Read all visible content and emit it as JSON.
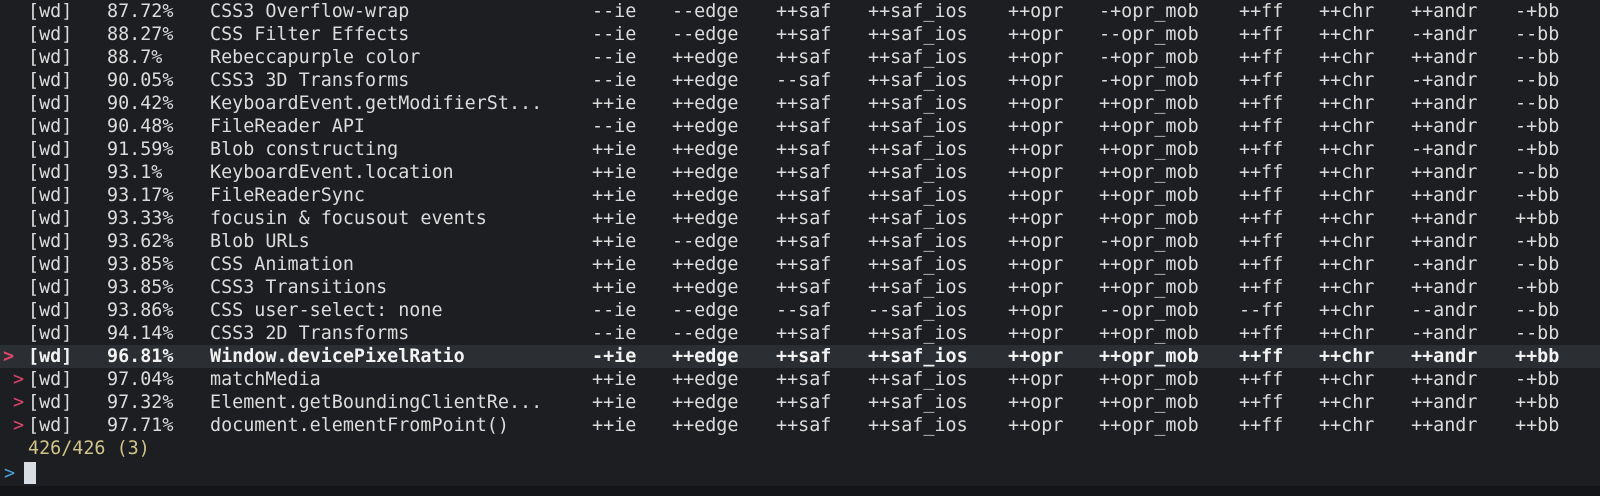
{
  "rows": [
    {
      "marker": "",
      "tag": "[wd]",
      "pct": "87.72%",
      "name": "CSS3 Overflow-wrap",
      "ie": "--ie",
      "edge": "--edge",
      "saf": "++saf",
      "saf_ios": "++saf_ios",
      "opr": "++opr",
      "opr_mob": "-+opr_mob",
      "ff": "++ff",
      "chr": "++chr",
      "andr": "++andr",
      "bb": "-+bb"
    },
    {
      "marker": "",
      "tag": "[wd]",
      "pct": "88.27%",
      "name": "CSS Filter Effects",
      "ie": "--ie",
      "edge": "--edge",
      "saf": "++saf",
      "saf_ios": "++saf_ios",
      "opr": "++opr",
      "opr_mob": "--opr_mob",
      "ff": "++ff",
      "chr": "++chr",
      "andr": "-+andr",
      "bb": "--bb"
    },
    {
      "marker": "",
      "tag": "[wd]",
      "pct": "88.7%",
      "name": "Rebeccapurple color",
      "ie": "--ie",
      "edge": "++edge",
      "saf": "++saf",
      "saf_ios": "++saf_ios",
      "opr": "++opr",
      "opr_mob": "-+opr_mob",
      "ff": "++ff",
      "chr": "++chr",
      "andr": "++andr",
      "bb": "--bb"
    },
    {
      "marker": "",
      "tag": "[wd]",
      "pct": "90.05%",
      "name": "CSS3 3D Transforms",
      "ie": "--ie",
      "edge": "++edge",
      "saf": "--saf",
      "saf_ios": "++saf_ios",
      "opr": "++opr",
      "opr_mob": "-+opr_mob",
      "ff": "++ff",
      "chr": "++chr",
      "andr": "-+andr",
      "bb": "--bb"
    },
    {
      "marker": "",
      "tag": "[wd]",
      "pct": "90.42%",
      "name": "KeyboardEvent.getModifierSt...",
      "ie": "++ie",
      "edge": "++edge",
      "saf": "++saf",
      "saf_ios": "++saf_ios",
      "opr": "++opr",
      "opr_mob": "++opr_mob",
      "ff": "++ff",
      "chr": "++chr",
      "andr": "++andr",
      "bb": "--bb"
    },
    {
      "marker": "",
      "tag": "[wd]",
      "pct": "90.48%",
      "name": "FileReader API",
      "ie": "--ie",
      "edge": "++edge",
      "saf": "++saf",
      "saf_ios": "++saf_ios",
      "opr": "++opr",
      "opr_mob": "++opr_mob",
      "ff": "++ff",
      "chr": "++chr",
      "andr": "++andr",
      "bb": "-+bb"
    },
    {
      "marker": "",
      "tag": "[wd]",
      "pct": "91.59%",
      "name": "Blob constructing",
      "ie": "++ie",
      "edge": "++edge",
      "saf": "++saf",
      "saf_ios": "++saf_ios",
      "opr": "++opr",
      "opr_mob": "++opr_mob",
      "ff": "++ff",
      "chr": "++chr",
      "andr": "-+andr",
      "bb": "-+bb"
    },
    {
      "marker": "",
      "tag": "[wd]",
      "pct": "93.1%",
      "name": "KeyboardEvent.location",
      "ie": "++ie",
      "edge": "++edge",
      "saf": "++saf",
      "saf_ios": "++saf_ios",
      "opr": "++opr",
      "opr_mob": "++opr_mob",
      "ff": "++ff",
      "chr": "++chr",
      "andr": "++andr",
      "bb": "--bb"
    },
    {
      "marker": "",
      "tag": "[wd]",
      "pct": "93.17%",
      "name": "FileReaderSync",
      "ie": "++ie",
      "edge": "++edge",
      "saf": "++saf",
      "saf_ios": "++saf_ios",
      "opr": "++opr",
      "opr_mob": "++opr_mob",
      "ff": "++ff",
      "chr": "++chr",
      "andr": "++andr",
      "bb": "-+bb"
    },
    {
      "marker": "",
      "tag": "[wd]",
      "pct": "93.33%",
      "name": "focusin & focusout events",
      "ie": "++ie",
      "edge": "++edge",
      "saf": "++saf",
      "saf_ios": "++saf_ios",
      "opr": "++opr",
      "opr_mob": "++opr_mob",
      "ff": "++ff",
      "chr": "++chr",
      "andr": "++andr",
      "bb": "++bb"
    },
    {
      "marker": "",
      "tag": "[wd]",
      "pct": "93.62%",
      "name": "Blob URLs",
      "ie": "++ie",
      "edge": "--edge",
      "saf": "++saf",
      "saf_ios": "++saf_ios",
      "opr": "++opr",
      "opr_mob": "-+opr_mob",
      "ff": "++ff",
      "chr": "++chr",
      "andr": "++andr",
      "bb": "-+bb"
    },
    {
      "marker": "",
      "tag": "[wd]",
      "pct": "93.85%",
      "name": "CSS Animation",
      "ie": "++ie",
      "edge": "++edge",
      "saf": "++saf",
      "saf_ios": "++saf_ios",
      "opr": "++opr",
      "opr_mob": "++opr_mob",
      "ff": "++ff",
      "chr": "++chr",
      "andr": "-+andr",
      "bb": "--bb"
    },
    {
      "marker": "",
      "tag": "[wd]",
      "pct": "93.85%",
      "name": "CSS3 Transitions",
      "ie": "++ie",
      "edge": "++edge",
      "saf": "++saf",
      "saf_ios": "++saf_ios",
      "opr": "++opr",
      "opr_mob": "++opr_mob",
      "ff": "++ff",
      "chr": "++chr",
      "andr": "++andr",
      "bb": "-+bb"
    },
    {
      "marker": "",
      "tag": "[wd]",
      "pct": "93.86%",
      "name": "CSS user-select: none",
      "ie": "--ie",
      "edge": "--edge",
      "saf": "--saf",
      "saf_ios": "--saf_ios",
      "opr": "++opr",
      "opr_mob": "--opr_mob",
      "ff": "--ff",
      "chr": "++chr",
      "andr": "--andr",
      "bb": "--bb"
    },
    {
      "marker": "",
      "tag": "[wd]",
      "pct": "94.14%",
      "name": "CSS3 2D Transforms",
      "ie": "--ie",
      "edge": "--edge",
      "saf": "++saf",
      "saf_ios": "++saf_ios",
      "opr": "++opr",
      "opr_mob": "++opr_mob",
      "ff": "++ff",
      "chr": "++chr",
      "andr": "-+andr",
      "bb": "--bb"
    },
    {
      "marker": ">",
      "tag": "[wd]",
      "pct": "96.81%",
      "name": "Window.devicePixelRatio",
      "ie": "-+ie",
      "edge": "++edge",
      "saf": "++saf",
      "saf_ios": "++saf_ios",
      "opr": "++opr",
      "opr_mob": "++opr_mob",
      "ff": "++ff",
      "chr": "++chr",
      "andr": "++andr",
      "bb": "++bb"
    },
    {
      "marker": ">",
      "tag": "[wd]",
      "pct": "97.04%",
      "name": "matchMedia",
      "ie": "++ie",
      "edge": "++edge",
      "saf": "++saf",
      "saf_ios": "++saf_ios",
      "opr": "++opr",
      "opr_mob": "++opr_mob",
      "ff": "++ff",
      "chr": "++chr",
      "andr": "++andr",
      "bb": "-+bb"
    },
    {
      "marker": ">",
      "tag": "[wd]",
      "pct": "97.32%",
      "name": "Element.getBoundingClientRe...",
      "ie": "++ie",
      "edge": "++edge",
      "saf": "++saf",
      "saf_ios": "++saf_ios",
      "opr": "++opr",
      "opr_mob": "++opr_mob",
      "ff": "++ff",
      "chr": "++chr",
      "andr": "++andr",
      "bb": "++bb"
    },
    {
      "marker": ">",
      "tag": "[wd]",
      "pct": "97.71%",
      "name": "document.elementFromPoint()",
      "ie": "++ie",
      "edge": "++edge",
      "saf": "++saf",
      "saf_ios": "++saf_ios",
      "opr": "++opr",
      "opr_mob": "++opr_mob",
      "ff": "++ff",
      "chr": "++chr",
      "andr": "++andr",
      "bb": "++bb"
    }
  ],
  "current_row_index": 15,
  "status": {
    "count": "426/426 (3)"
  },
  "prompt": {
    "symbol": ">",
    "query": ""
  },
  "colors": {
    "background": "#1c1e21",
    "current_row": "#2b2e33",
    "marker": "#e0456b",
    "status": "#d0c48a",
    "prompt": "#4aa0d8"
  }
}
